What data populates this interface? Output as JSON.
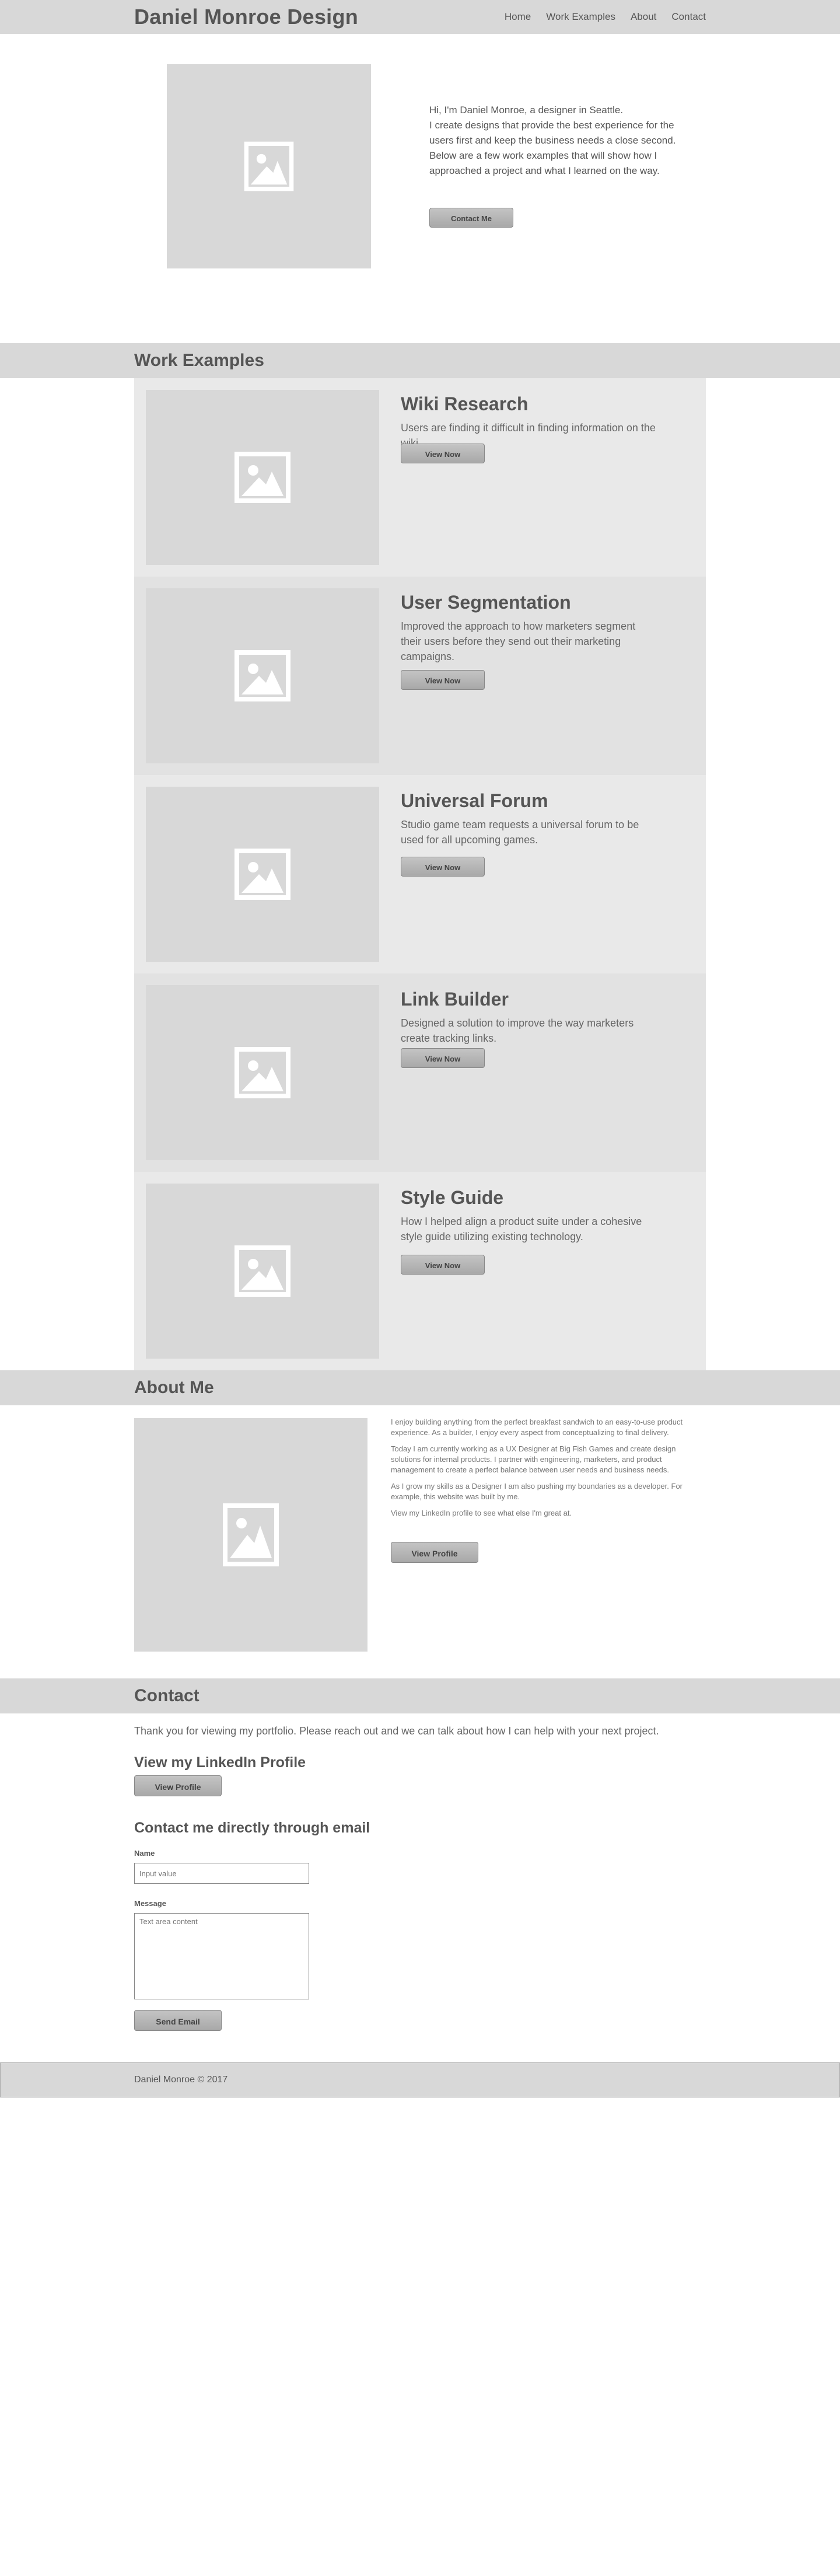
{
  "header": {
    "logo": "Daniel Monroe Design",
    "nav": [
      "Home",
      "Work Examples",
      "About",
      "Contact"
    ]
  },
  "hero": {
    "line1": "Hi, I'm Daniel Monroe, a designer in Seattle.",
    "line2": "I create designs that provide the best experience for the users first and keep the business needs a close second. Below are a few work examples that will show how I approached a project and what I learned on the way.",
    "button": "Contact Me"
  },
  "work": {
    "title": "Work Examples",
    "items": [
      {
        "title": "Wiki Research",
        "desc": "Users are finding it difficult in finding information on the wiki.",
        "button": "View Now"
      },
      {
        "title": "User Segmentation",
        "desc": "Improved the approach to how marketers segment their users before they send out their marketing campaigns.",
        "button": "View Now"
      },
      {
        "title": "Universal Forum",
        "desc": "Studio game team requests a universal forum to be used for all upcoming games.",
        "button": "View Now"
      },
      {
        "title": "Link Builder",
        "desc": "Designed a solution to improve the way marketers create tracking links.",
        "button": "View Now"
      },
      {
        "title": "Style Guide",
        "desc": "How I helped align a product suite under a cohesive style guide utilizing existing technology.",
        "button": "View Now"
      }
    ]
  },
  "about": {
    "title": "About Me",
    "paragraphs": [
      "I enjoy building anything from the perfect breakfast sandwich to an easy-to-use product experience. As a builder, I enjoy every aspect from conceptualizing to final delivery.",
      "Today I am currently working as a UX Designer at Big Fish Games and create design solutions for internal products. I partner with engineering, marketers, and product management to create a perfect balance between user needs and business needs.",
      "As I grow my skills as a Designer I am also pushing my boundaries as a developer. For example, this website was built by me.",
      "View my LinkedIn profile to see what else I'm great at."
    ],
    "button": "View Profile"
  },
  "contact": {
    "title": "Contact",
    "intro": "Thank you for viewing my portfolio. Please reach out and we can talk about how I can help with your next project.",
    "linkedin_heading": "View my LinkedIn Profile",
    "linkedin_button": "View Profile",
    "email_heading": "Contact me directly through email",
    "name_label": "Name",
    "name_placeholder": "Input value",
    "message_label": "Message",
    "message_placeholder": "Text area content",
    "send_button": "Send Email"
  },
  "footer": {
    "copyright": "Daniel Monroe © 2017"
  },
  "icons": {
    "placeholder": "image-placeholder-icon"
  }
}
